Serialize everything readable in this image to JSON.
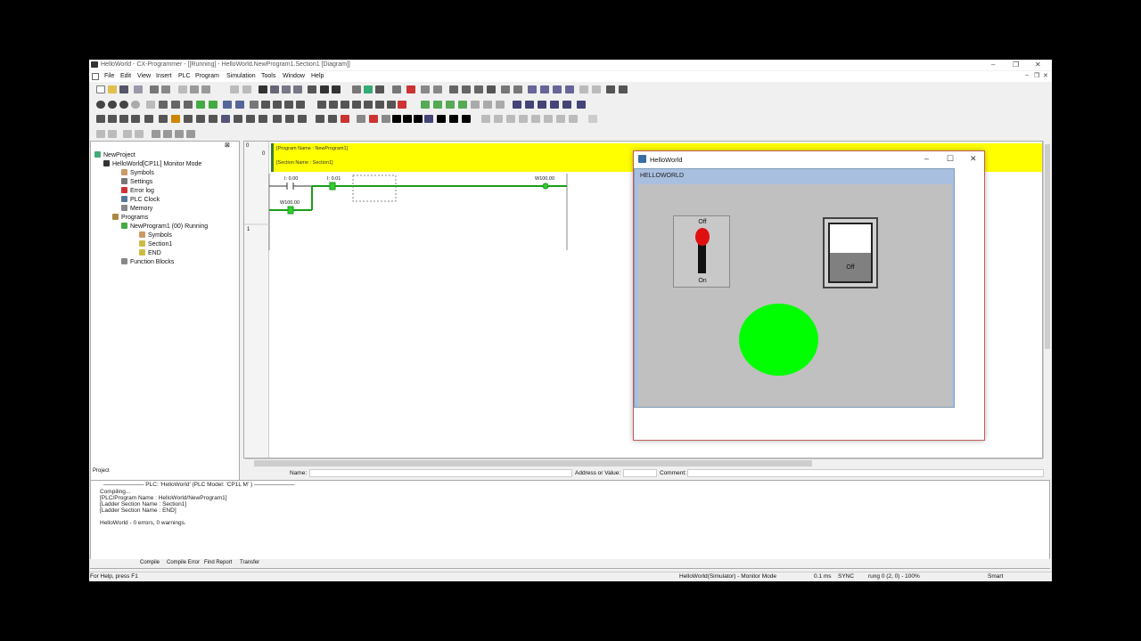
{
  "app": {
    "title": "HelloWorld - CX-Programmer - [[Running] - HelloWorld.NewProgram1.Section1 [Diagram]]",
    "controls": [
      "–",
      "❐",
      "✕"
    ],
    "menu": [
      "File",
      "Edit",
      "View",
      "Insert",
      "PLC",
      "Program",
      "Simulation",
      "Tools",
      "Window",
      "Help"
    ],
    "child_controls": [
      "–",
      "❐",
      "✕"
    ]
  },
  "tree": {
    "items": [
      {
        "label": "NewProject",
        "icon": "project-icon"
      },
      {
        "label": "HelloWorld[CP1L] Monitor Mode",
        "icon": "plc-icon"
      },
      {
        "label": "Symbols",
        "icon": "symbols-icon"
      },
      {
        "label": "Settings",
        "icon": "settings-icon"
      },
      {
        "label": "Error log",
        "icon": "error-log-icon"
      },
      {
        "label": "PLC Clock",
        "icon": "clock-icon"
      },
      {
        "label": "Memory",
        "icon": "memory-icon"
      },
      {
        "label": "Programs",
        "icon": "programs-icon"
      },
      {
        "label": "NewProgram1 (00) Running",
        "icon": "program-icon"
      },
      {
        "label": "Symbols",
        "icon": "symbols-icon"
      },
      {
        "label": "Section1",
        "icon": "section-icon"
      },
      {
        "label": "END",
        "icon": "section-icon"
      },
      {
        "label": "Function Blocks",
        "icon": "function-blocks-icon"
      }
    ],
    "tab": "Project"
  },
  "ladder": {
    "rung_numbers": [
      "0",
      "0",
      "1"
    ],
    "program_name": "[Program Name : NewProgram1]",
    "section_name": "[Section Name : Section1]",
    "contact1": "I: 0.00",
    "contact2": "I: 0.01",
    "coil": "W100.00",
    "holding_contact": "W100.00"
  },
  "addr": {
    "name_label": "Name:",
    "address_label": "Address or Value:",
    "comment_label": "Comment:"
  },
  "output": {
    "header": "——————— PLC: 'HelloWorld' (PLC Model: 'CP1L M' ) ———————",
    "lines": [
      "Compiling...",
      "[PLC/Program Name : HelloWorld/NewProgram1]",
      "[Ladder Section Name : Section1]",
      "[Ladder Section Name : END]",
      "",
      "HelloWorld - 0 errors, 0 warnings."
    ],
    "tabs": [
      "Compile",
      "Compile Error",
      "Find Report",
      "Transfer"
    ]
  },
  "status": {
    "help": "For Help, press F1",
    "sim": "HelloWorld(Simulator) - Monitor Mode",
    "time": "0.1 ms",
    "sync": "SYNC",
    "rung": "rung 0 (2, 0)  - 100%",
    "mode": "Smart"
  },
  "hw": {
    "title": "HelloWorld",
    "panel_title": "HELLOWORLD",
    "toggle_off": "Off",
    "toggle_on": "On",
    "rocker_label": "Off",
    "lamp_color": "#00ff00",
    "controls": [
      "–",
      "☐",
      "✕"
    ]
  }
}
